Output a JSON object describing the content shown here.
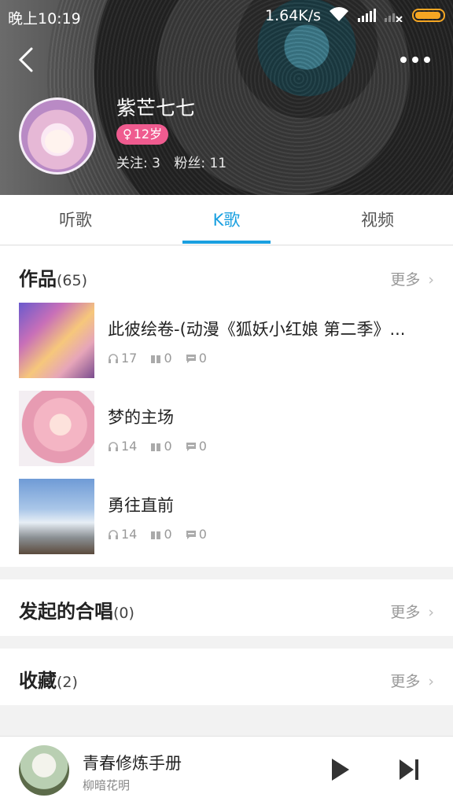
{
  "status_bar": {
    "time": "晚上10:19",
    "speed": "1.64K/s",
    "battery_color": "#f5a623"
  },
  "header": {
    "back_icon": "back-icon",
    "more_icon": "more-icon"
  },
  "profile": {
    "name": "紫芒七七",
    "gender_symbol": "♀",
    "age": "12岁",
    "badge_color": "#ef5b8f",
    "follows_label": "关注: 3",
    "fans_label": "粉丝: 11"
  },
  "tabs": [
    {
      "label": "听歌",
      "active": false
    },
    {
      "label": "K歌",
      "active": true
    },
    {
      "label": "视频",
      "active": false
    }
  ],
  "accent_color": "#1aa0e0",
  "works": {
    "title": "作品",
    "count": "(65)",
    "more_label": "更多",
    "items": [
      {
        "title": "此彼绘卷-(动漫《狐妖小红娘 第二季》...",
        "listens": "17",
        "gifts": "0",
        "comments": "0"
      },
      {
        "title": "梦的主场",
        "listens": "14",
        "gifts": "0",
        "comments": "0"
      },
      {
        "title": "勇往直前",
        "listens": "14",
        "gifts": "0",
        "comments": "0"
      }
    ]
  },
  "chorus": {
    "title": "发起的合唱",
    "count": "(0)",
    "more_label": "更多"
  },
  "favorites": {
    "title": "收藏",
    "count": "(2)",
    "more_label": "更多"
  },
  "player": {
    "song_title": "青春修炼手册",
    "artist": "柳暗花明"
  }
}
